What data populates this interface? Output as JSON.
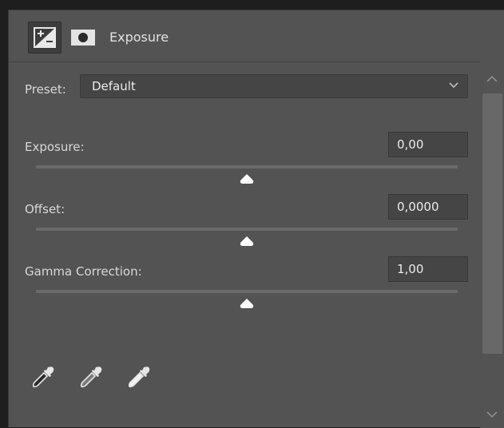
{
  "header": {
    "title": "Exposure"
  },
  "preset": {
    "label": "Preset:",
    "value": "Default"
  },
  "adjustments": [
    {
      "label": "Exposure:",
      "value": "0,00",
      "slider_fraction": 0.5
    },
    {
      "label": "Offset:",
      "value": "0,0000",
      "slider_fraction": 0.5
    },
    {
      "label": "Gamma Correction:",
      "value": "1,00",
      "slider_fraction": 0.5
    }
  ],
  "eyedroppers": [
    "black-point-eyedropper-icon",
    "gray-point-eyedropper-icon",
    "white-point-eyedropper-icon"
  ],
  "colors": {
    "panel_bg": "#535353",
    "field_bg": "#454545",
    "track": "#6a6a6a",
    "thumb": "#ffffff"
  }
}
